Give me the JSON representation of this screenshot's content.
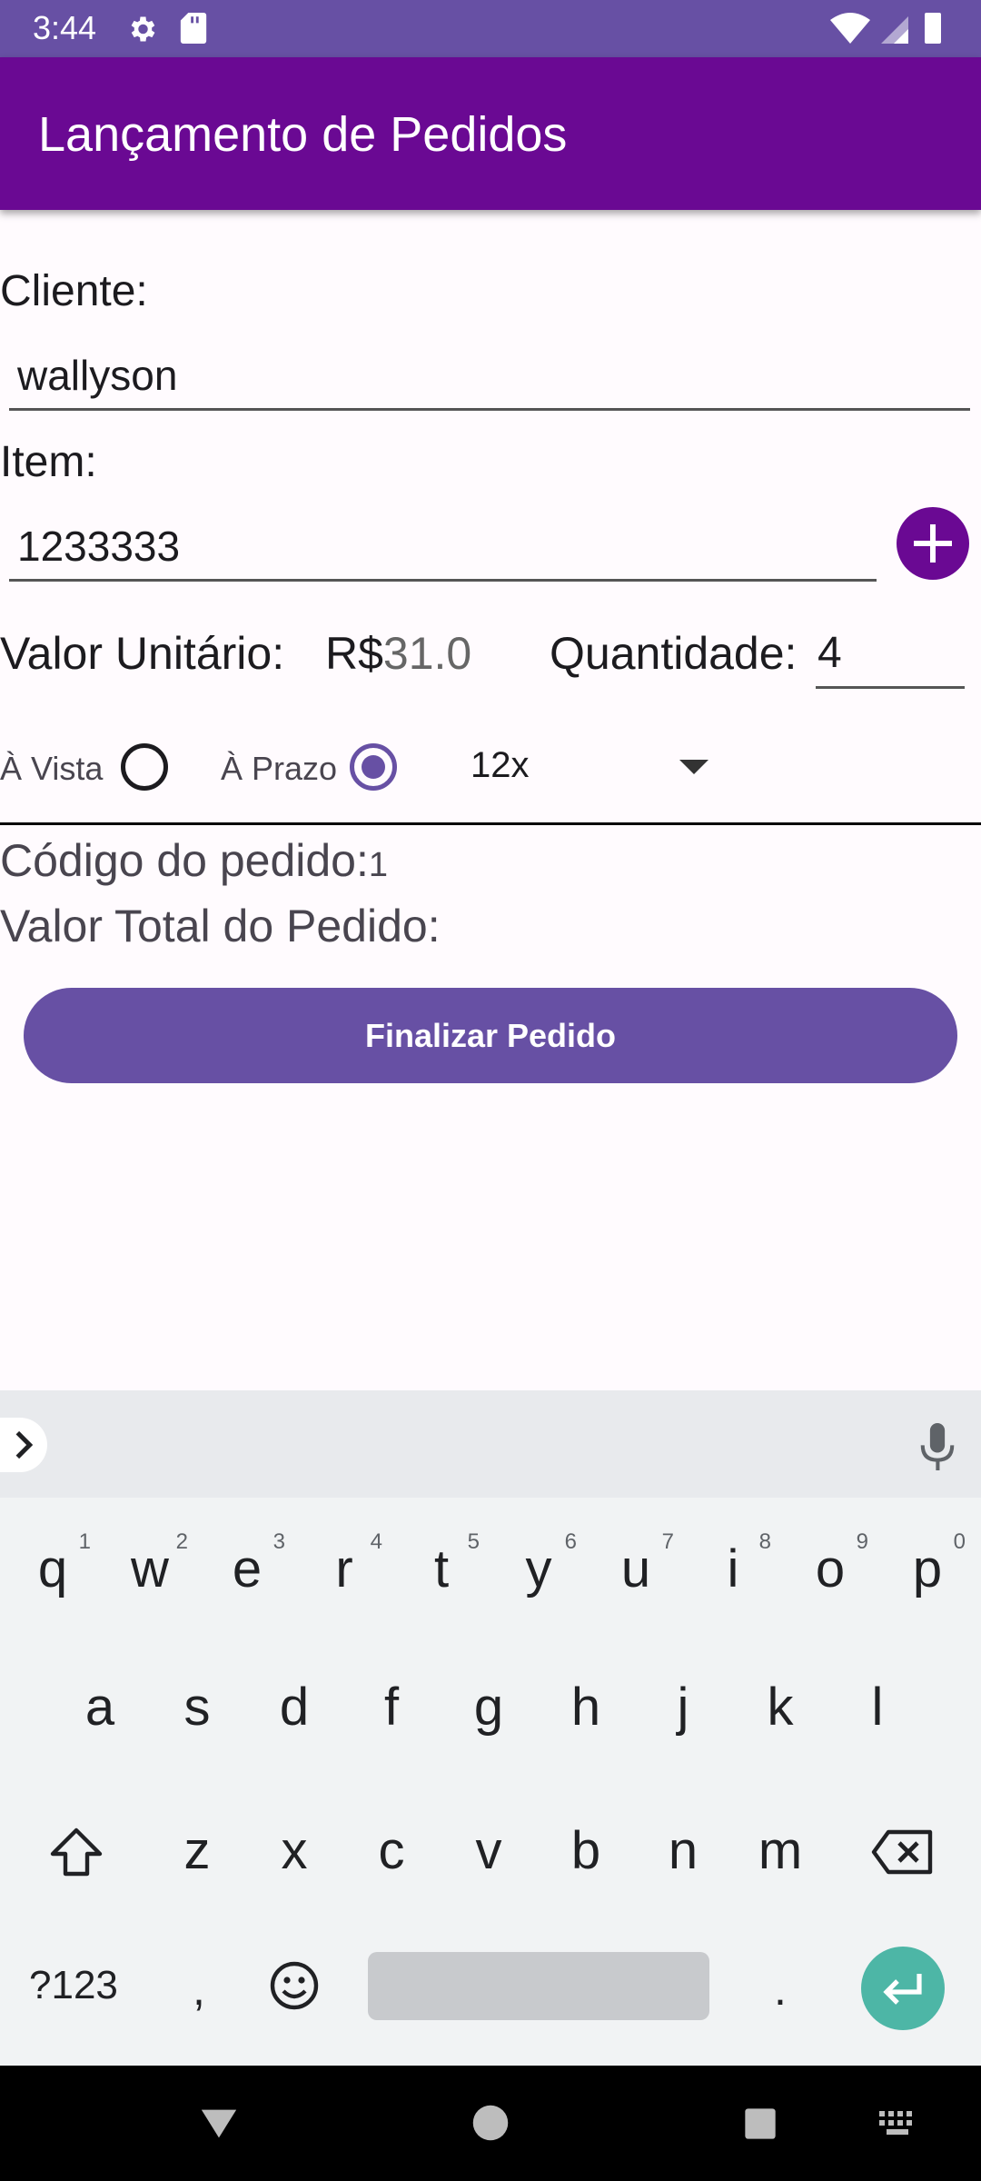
{
  "status": {
    "time": "3:44"
  },
  "app": {
    "title": "Lançamento de Pedidos"
  },
  "form": {
    "cliente_label": "Cliente:",
    "cliente_value": "wallyson",
    "item_label": "Item:",
    "item_value": "1233333",
    "valor_label": "Valor Unitário:",
    "currency": "R$",
    "valor_value": "31.0",
    "quantidade_label": "Quantidade:",
    "quantidade_value": "4",
    "avista_label": "À Vista",
    "aprazo_label": "À Prazo",
    "selected_payment": "À Prazo",
    "installments": "12x",
    "codigo_label": "Código do pedido:",
    "codigo_value": "1",
    "total_label": "Valor Total do Pedido:",
    "finalize_label": "Finalizar Pedido"
  },
  "keyboard": {
    "row1": [
      {
        "k": "q",
        "n": "1"
      },
      {
        "k": "w",
        "n": "2"
      },
      {
        "k": "e",
        "n": "3"
      },
      {
        "k": "r",
        "n": "4"
      },
      {
        "k": "t",
        "n": "5"
      },
      {
        "k": "y",
        "n": "6"
      },
      {
        "k": "u",
        "n": "7"
      },
      {
        "k": "i",
        "n": "8"
      },
      {
        "k": "o",
        "n": "9"
      },
      {
        "k": "p",
        "n": "0"
      }
    ],
    "row2": [
      "a",
      "s",
      "d",
      "f",
      "g",
      "h",
      "j",
      "k",
      "l"
    ],
    "row3": [
      "z",
      "x",
      "c",
      "v",
      "b",
      "n",
      "m"
    ],
    "symbols_label": "?123",
    "comma": ",",
    "period": "."
  },
  "colors": {
    "primary": "#6750a4",
    "app_bar": "#6a0993",
    "enter": "#4db6a6"
  }
}
